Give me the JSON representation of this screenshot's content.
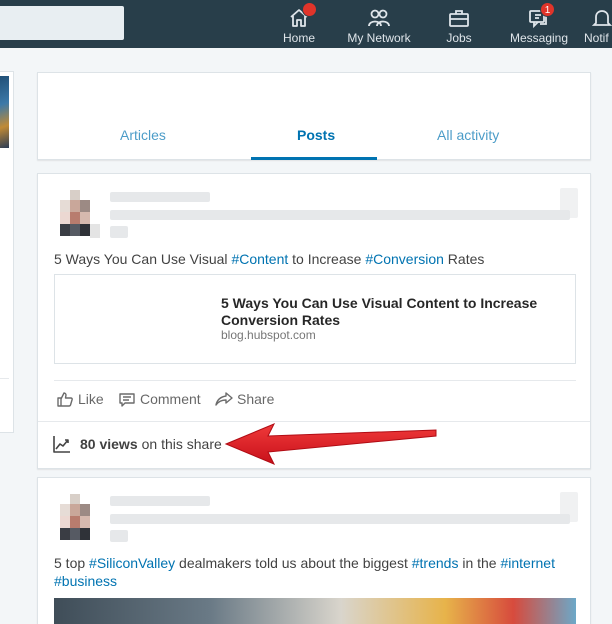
{
  "nav": {
    "items": [
      {
        "label": "Home",
        "badge": ""
      },
      {
        "label": "My Network",
        "badge": ""
      },
      {
        "label": "Jobs",
        "badge": ""
      },
      {
        "label": "Messaging",
        "badge": "1"
      },
      {
        "label": "Notif",
        "badge": ""
      }
    ]
  },
  "tabs": [
    {
      "label": "Articles",
      "active": false
    },
    {
      "label": "Posts",
      "active": true
    },
    {
      "label": "All activity",
      "active": false
    }
  ],
  "post1": {
    "text_parts": [
      "5 Ways You Can Use Visual ",
      "#Content",
      " to Increase ",
      "#Conversion",
      " Rates"
    ],
    "link_title": "5 Ways You Can Use Visual Content to Increase Conversion Rates",
    "link_domain": "blog.hubspot.com",
    "actions": {
      "like": "Like",
      "comment": "Comment",
      "share": "Share"
    },
    "views_count": "80 views",
    "views_suffix": "on this share"
  },
  "post2": {
    "text_parts": [
      "5 top ",
      "#SiliconValley",
      " dealmakers told us about the biggest ",
      "#trends",
      " in the ",
      "#internet",
      "#business"
    ]
  },
  "colors": {
    "nav_bg": "#283e4a",
    "accent": "#0073b1",
    "arrow": "#e0141e",
    "badge": "#e0342a"
  }
}
